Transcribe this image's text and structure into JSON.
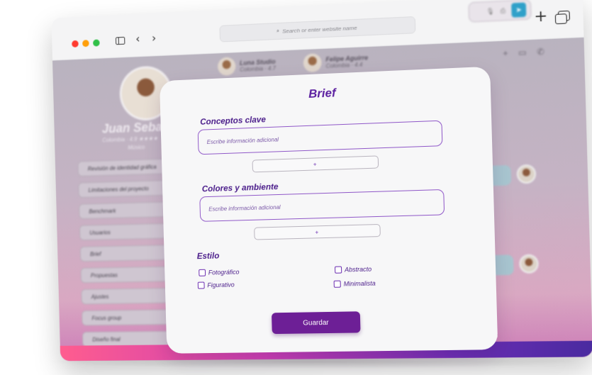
{
  "browser": {
    "address_placeholder": "Search or enter website name"
  },
  "profile": {
    "name": "Juan Sebastia",
    "meta": "Colombia · 4.9 ★★★★",
    "role": "Músico"
  },
  "menu": {
    "items": [
      {
        "label": "Revisión de identidad gráfica"
      },
      {
        "label": "Limitaciones del proyecto"
      },
      {
        "label": "Benchmark"
      },
      {
        "label": "Usuarios"
      },
      {
        "label": "Brief"
      },
      {
        "label": "Propuestas"
      },
      {
        "label": "Ajustes"
      },
      {
        "label": "Focus group"
      },
      {
        "label": "Diseño final"
      }
    ]
  },
  "contacts": [
    {
      "name": "Luna Studio",
      "meta": "Colombia · 4.7"
    },
    {
      "name": "Felipe Aguirre",
      "meta": "Colombia · 4.4"
    }
  ],
  "modal": {
    "title": "Brief",
    "sections": [
      {
        "label": "Conceptos clave",
        "placeholder": "Escribe información adicional",
        "add_label": "+"
      },
      {
        "label": "Colores y ambiente",
        "placeholder": "Escribe información adicional",
        "add_label": "+"
      }
    ],
    "style_label": "Estilo",
    "options": [
      "Fotográfico",
      "Figurativo",
      "Abstracto",
      "Minimalista"
    ],
    "save_label": "Guardar"
  },
  "colors": {
    "accent": "#6d1f96",
    "title": "#5b1fa0",
    "send": "#2fa0c9"
  }
}
